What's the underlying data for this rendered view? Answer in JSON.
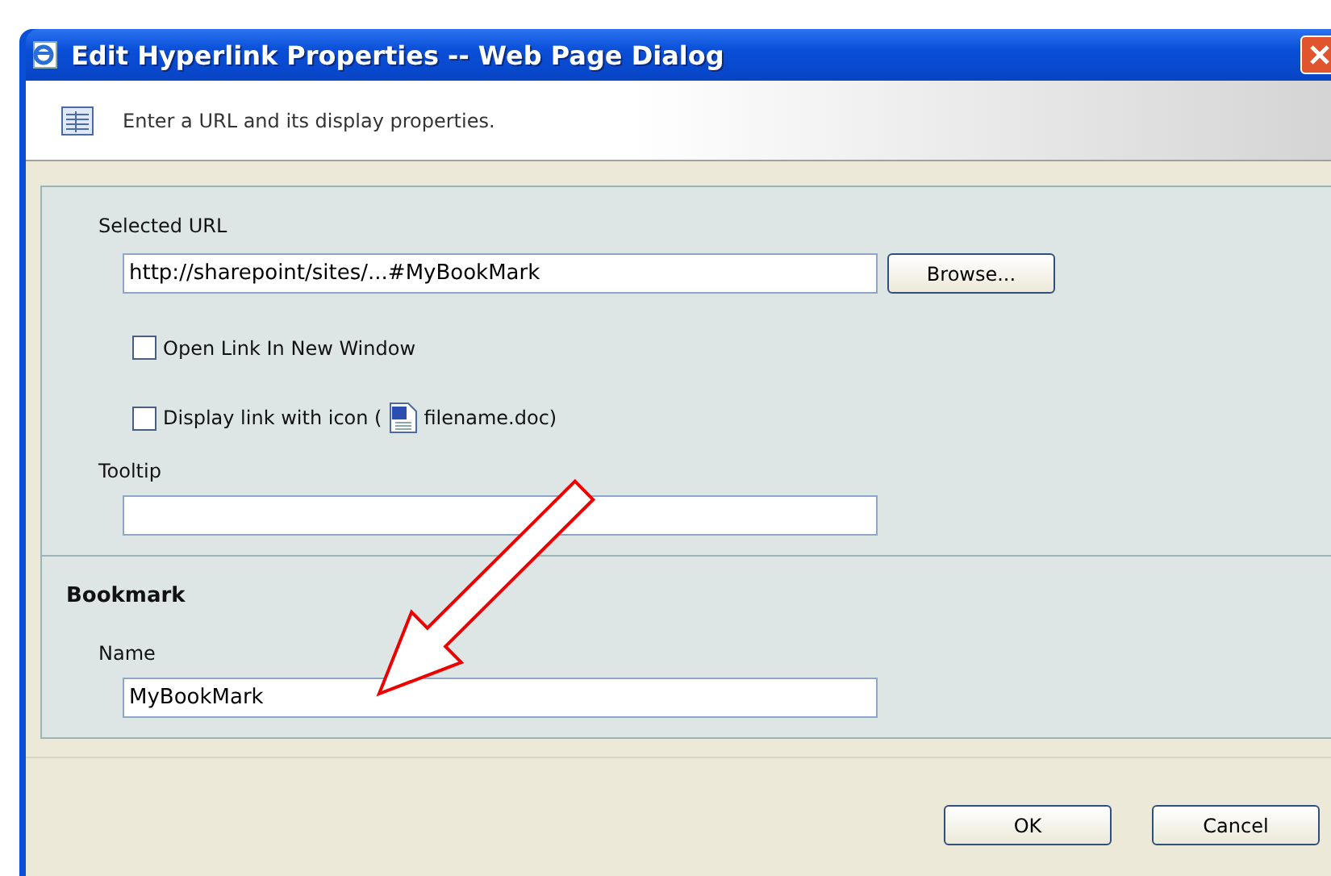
{
  "window": {
    "title": "Edit Hyperlink Properties -- Web Page Dialog"
  },
  "header": {
    "message": "Enter a URL and its display properties."
  },
  "url": {
    "label": "Selected URL",
    "value": "http://sharepoint/sites/...#MyBookMark",
    "button": "Browse..."
  },
  "options": [
    {
      "kind": "plain",
      "label": "Open Link In New Window",
      "checked": false
    },
    {
      "kind": "with_icon",
      "label": "Display link with icon (",
      "after": "filename.doc)",
      "checked": false
    }
  ],
  "tooltip": {
    "label": "Tooltip"
  },
  "bookmark": {
    "heading": "Bookmark",
    "label": "Name",
    "value": "MyBookMark"
  },
  "buttons": [
    "OK",
    "Cancel"
  ]
}
